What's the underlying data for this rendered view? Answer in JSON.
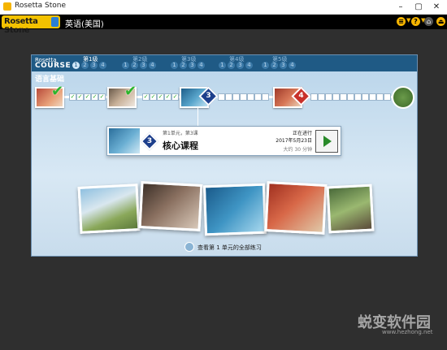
{
  "window": {
    "title": "Rosetta Stone"
  },
  "topbar": {
    "brand": "Rosetta Stone",
    "language": "英语(美国)"
  },
  "course": {
    "label_top": "Rosetta",
    "label_bottom": "COURSE",
    "levels": [
      "第1级",
      "第2级",
      "第3级",
      "第4级",
      "第5级"
    ],
    "units": [
      "1",
      "2",
      "3",
      "4"
    ],
    "section_title": "语言基础"
  },
  "progress": {
    "lesson3_number": "3",
    "lesson4_number": "4"
  },
  "lesson_card": {
    "meta": "第1单元，第3课",
    "name": "核心课程",
    "status": "正在进行",
    "date": "2017年5月23日",
    "eta": "大约 30 分钟",
    "number": "3"
  },
  "footer_link": "查看第 1 单元的全部练习",
  "watermark": {
    "main": "蜕变软件园",
    "sub": "www.hezhong.net"
  },
  "colors": {
    "accent": "#f5b400",
    "panel_header": "#1f5a85",
    "check": "#2bb52b",
    "lesson3": "#1d3f8c",
    "lesson4": "#c8302a"
  }
}
